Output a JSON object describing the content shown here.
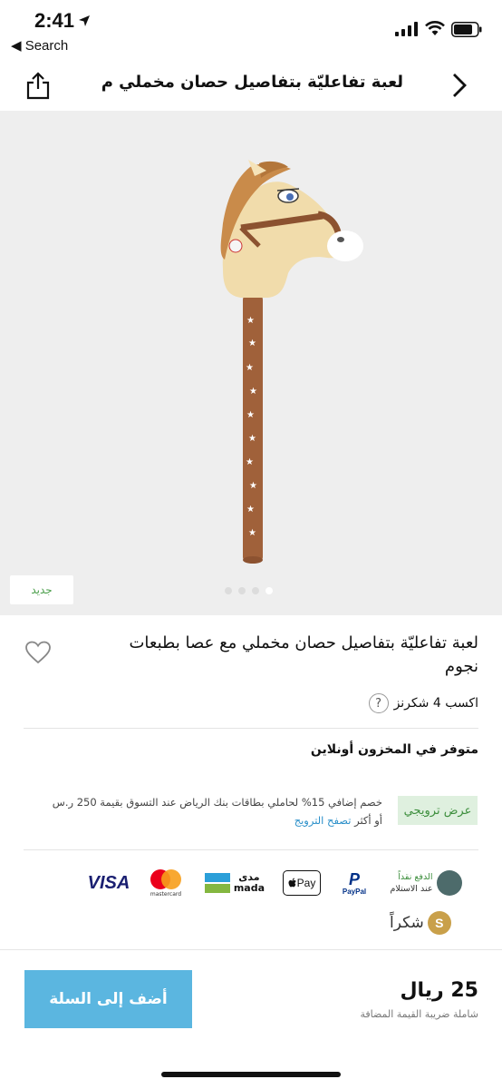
{
  "status_bar": {
    "time": "2:41",
    "back_label": "◀ Search"
  },
  "header": {
    "title": "لعبة تفاعليّة بتفاصيل حصان مخملي م..."
  },
  "gallery": {
    "badge": "جديد",
    "image_count": 4,
    "active_index": 3
  },
  "product": {
    "title": "لعبة تفاعليّة بتفاصيل حصان مخملي مع عصا بطبعات نجوم",
    "shukrans": "اكسب 4 شكرنز",
    "help_symbol": "?",
    "stock": "متوفر في المخزون أونلاين"
  },
  "promo": {
    "tag": "عرض ترويجي",
    "text": "خصم إضافي 15% لحاملي بطاقات بنك الرياض عند التسوق بقيمة 250 ر.س أو أكثر",
    "link": "تصفح الترويج"
  },
  "payments": {
    "visa": "VISA",
    "mastercard": "mastercard",
    "mada_ar": "مدى",
    "mada_en": "mada",
    "applepay": "Pay",
    "paypal": "PayPal",
    "cod_line1": "الدفع نقداً",
    "cod_line2": "عند الاستلام",
    "shukran_symbol": "S",
    "shukran_word": "شكراً"
  },
  "footer": {
    "add_to_cart": "أضف إلى السلة",
    "price": "25 ريال",
    "vat_note": "شاملة ضريبة القيمة المضافة"
  },
  "colors": {
    "accent_blue": "#5bb6e0",
    "promo_green": "#3c8e3c",
    "link_blue": "#2a8fc9"
  }
}
